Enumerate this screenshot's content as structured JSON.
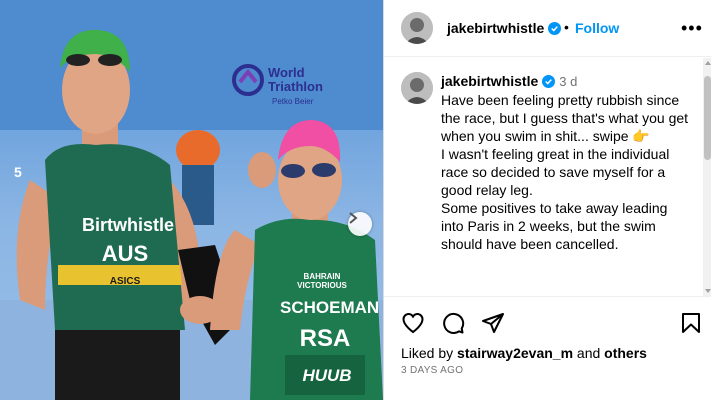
{
  "photo": {
    "logo_line1": "World",
    "logo_line2": "Triathlon",
    "photo_credit": "Petko Beier",
    "left_athlete": {
      "name": "Birtwhistle",
      "country": "AUS",
      "sponsor": "ASICS",
      "race_number": "5"
    },
    "right_athlete": {
      "name": "SCHOEMAN",
      "country": "RSA",
      "sponsor": "BAHRAIN VICTORIOUS",
      "brand": "HUUB"
    }
  },
  "header": {
    "username": "jakebirtwhistle",
    "separator": "•",
    "follow_label": "Follow",
    "more_label": "•••"
  },
  "post": {
    "username": "jakebirtwhistle",
    "time_ago": "3 d",
    "caption_lines": [
      "Have been feeling pretty rubbish since",
      "the race, but I guess that's what you get",
      "when you swim in shit... swipe 👉",
      "I wasn't feeling great in the individual",
      "race so decided to save myself for a",
      "good relay leg.",
      "Some positives to take away leading",
      "into Paris in 2 weeks, but the swim",
      "should have been cancelled."
    ]
  },
  "footer": {
    "liked_by_prefix": "Liked by ",
    "liked_by_user": "stairway2evan_m",
    "liked_by_middle": " and ",
    "liked_by_others": "others",
    "date": "3 DAYS AGO"
  },
  "colors": {
    "follow_blue": "#0095f6",
    "verified_blue": "#0095f6",
    "secondary_text": "#737373",
    "aus_suit_green": "#1f6b52",
    "rsa_suit_green": "#1e7a4f"
  }
}
